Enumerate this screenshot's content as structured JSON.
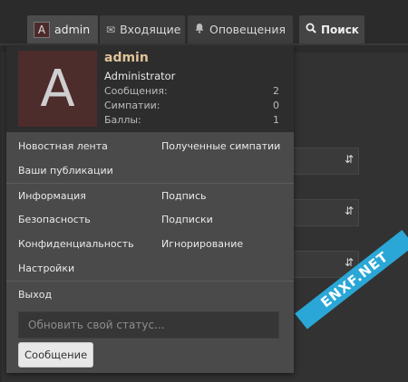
{
  "nav": {
    "tabs": [
      {
        "label": "admin",
        "avatar_letter": "A",
        "icon": "avatar"
      },
      {
        "label": "Входящие",
        "icon": "envelope-icon"
      },
      {
        "label": "Оповещения",
        "icon": "bell-icon"
      },
      {
        "label": "Поиск",
        "icon": "search-icon"
      }
    ]
  },
  "menu": {
    "user": {
      "avatar_letter": "A",
      "name": "admin",
      "role": "Administrator",
      "stats": [
        {
          "label": "Сообщения:",
          "value": "2"
        },
        {
          "label": "Симпатии:",
          "value": "0"
        },
        {
          "label": "Баллы:",
          "value": "1"
        }
      ]
    },
    "links": {
      "news_feed": "Новостная лента",
      "received_likes": "Полученные симпатии",
      "your_posts": "Ваши публикации",
      "info": "Информация",
      "signature": "Подпись",
      "security": "Безопасность",
      "subscriptions": "Подписки",
      "privacy": "Конфиденциальность",
      "ignoring": "Игнорирование",
      "settings": "Настройки",
      "logout": "Выход"
    },
    "status_placeholder": "Обновить свой статус...",
    "message_button": "Сообщение"
  },
  "colors": {
    "accent_name": "#e0c39a",
    "avatar_bg": "#4d2c2c",
    "watermark": "#2aa7d6"
  },
  "watermark": "ENXF.NET"
}
